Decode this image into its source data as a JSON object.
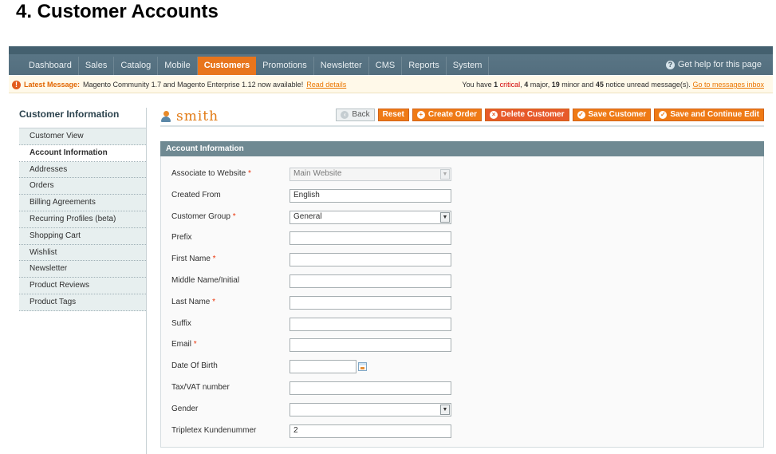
{
  "doc_title": "4. Customer Accounts",
  "nav": {
    "items": [
      "Dashboard",
      "Sales",
      "Catalog",
      "Mobile",
      "Customers",
      "Promotions",
      "Newsletter",
      "CMS",
      "Reports",
      "System"
    ],
    "active": "Customers",
    "help": "Get help for this page"
  },
  "message": {
    "latest_label": "Latest Message:",
    "latest_text": "Magento Community 1.7 and Magento Enterprise 1.12 now available!",
    "read_details": "Read details",
    "right_you_have": "You have",
    "critical_count": "1",
    "critical_label": "critical",
    "major_count": "4",
    "major_label": "major,",
    "minor_count": "19",
    "minor_label": "minor and",
    "notice_count": "45",
    "notice_label": "notice unread message(s).",
    "inbox_link": "Go to messages inbox"
  },
  "sidebar": {
    "title": "Customer Information",
    "tabs": [
      {
        "label": "Customer View"
      },
      {
        "label": "Account Information"
      },
      {
        "label": "Addresses"
      },
      {
        "label": "Orders"
      },
      {
        "label": "Billing Agreements"
      },
      {
        "label": "Recurring Profiles (beta)"
      },
      {
        "label": "Shopping Cart"
      },
      {
        "label": "Wishlist"
      },
      {
        "label": "Newsletter"
      },
      {
        "label": "Product Reviews"
      },
      {
        "label": "Product Tags"
      }
    ],
    "active_index": 1
  },
  "header": {
    "customer_name": "smith",
    "buttons": {
      "back": "Back",
      "reset": "Reset",
      "create_order": "Create Order",
      "delete_customer": "Delete Customer",
      "save_customer": "Save Customer",
      "save_continue": "Save and Continue Edit"
    }
  },
  "section": {
    "title": "Account Information",
    "fields": [
      {
        "label": "Associate to Website",
        "required": true,
        "type": "select",
        "value": "Main Website",
        "disabled": true
      },
      {
        "label": "Created From",
        "required": false,
        "type": "text",
        "value": "English"
      },
      {
        "label": "Customer Group",
        "required": true,
        "type": "select",
        "value": "General"
      },
      {
        "label": "Prefix",
        "required": false,
        "type": "text",
        "value": ""
      },
      {
        "label": "First Name",
        "required": true,
        "type": "text",
        "value": ""
      },
      {
        "label": "Middle Name/Initial",
        "required": false,
        "type": "text",
        "value": ""
      },
      {
        "label": "Last Name",
        "required": true,
        "type": "text",
        "value": ""
      },
      {
        "label": "Suffix",
        "required": false,
        "type": "text",
        "value": ""
      },
      {
        "label": "Email",
        "required": true,
        "type": "text",
        "value": ""
      },
      {
        "label": "Date Of Birth",
        "required": false,
        "type": "date",
        "value": ""
      },
      {
        "label": "Tax/VAT number",
        "required": false,
        "type": "text",
        "value": ""
      },
      {
        "label": "Gender",
        "required": false,
        "type": "select",
        "value": ""
      },
      {
        "label": "Tripletex Kundenummer",
        "required": false,
        "type": "text",
        "value": "2"
      }
    ]
  },
  "colors": {
    "accent": "#ef7a15",
    "nav_bg": "#536e7e",
    "section_head": "#6f8992"
  }
}
